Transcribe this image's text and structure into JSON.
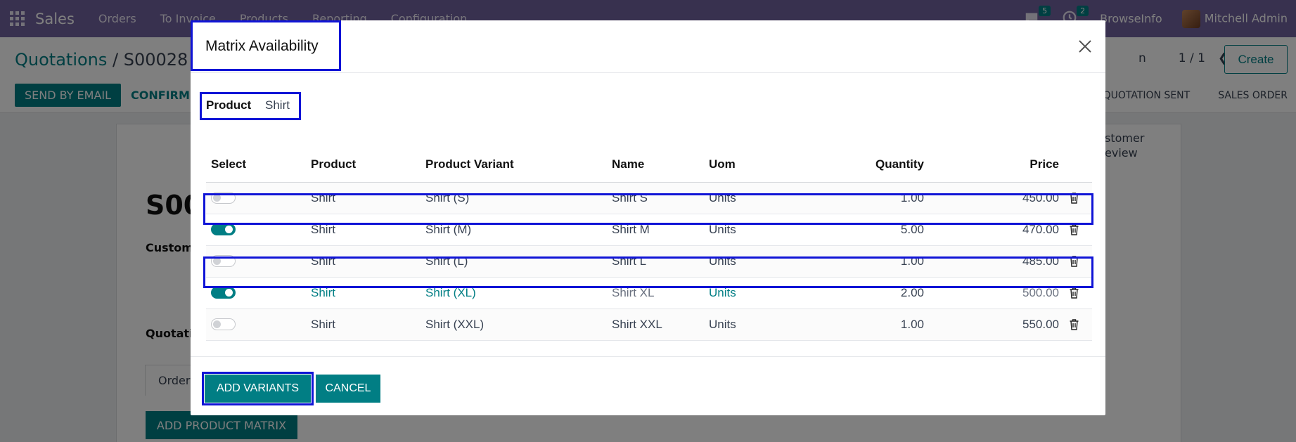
{
  "navbar": {
    "app_name": "Sales",
    "menu": [
      "Orders",
      "To Invoice",
      "Products",
      "Reporting",
      "Configuration"
    ],
    "chat_count": "5",
    "activity_count": "2",
    "company": "BrowseInfo",
    "user": "Mitchell Admin"
  },
  "control": {
    "breadcrumb_parent": "Quotations",
    "breadcrumb_sep": " / ",
    "breadcrumb_current": "S00028",
    "pager_partial": "n",
    "pager_value": "1 / 1",
    "create_label": "Create",
    "send_label": "SEND BY EMAIL",
    "confirm_label": "CONFIRM",
    "status_quotation_sent": "QUOTATION SENT",
    "status_sales_order": "SALES ORDER"
  },
  "sheet": {
    "title_partial": "S00",
    "customer_partial": "Custome",
    "quotation_partial": "Quotatio",
    "tab_partial": "Order",
    "review_line1": "stomer",
    "review_line2": "eview",
    "add_matrix_label": "ADD PRODUCT MATRIX"
  },
  "modal": {
    "title": "Matrix Availability",
    "product_label": "Product",
    "product_value": "Shirt",
    "columns": {
      "select": "Select",
      "product": "Product",
      "variant": "Product Variant",
      "name": "Name",
      "uom": "Uom",
      "quantity": "Quantity",
      "price": "Price"
    },
    "rows": [
      {
        "selected": false,
        "product": "Shirt",
        "variant": "Shirt (S)",
        "name": "Shirt S",
        "uom": "Units",
        "quantity": "1.00",
        "price": "450.00"
      },
      {
        "selected": true,
        "product": "Shirt",
        "variant": "Shirt (M)",
        "name": "Shirt M",
        "uom": "Units",
        "quantity": "5.00",
        "price": "470.00"
      },
      {
        "selected": false,
        "product": "Shirt",
        "variant": "Shirt (L)",
        "name": "Shirt L",
        "uom": "Units",
        "quantity": "1.00",
        "price": "485.00"
      },
      {
        "selected": true,
        "product": "Shirt",
        "variant": "Shirt (XL)",
        "name": "Shirt XL",
        "uom": "Units",
        "quantity": "2.00",
        "price": "500.00"
      },
      {
        "selected": false,
        "product": "Shirt",
        "variant": "Shirt (XXL)",
        "name": "Shirt XXL",
        "uom": "Units",
        "quantity": "1.00",
        "price": "550.00"
      }
    ],
    "add_variants_label": "ADD VARIANTS",
    "cancel_label": "CANCEL"
  },
  "colors": {
    "navbar": "#71639e",
    "accent": "#017e84",
    "highlight_box": "#1014d6"
  }
}
